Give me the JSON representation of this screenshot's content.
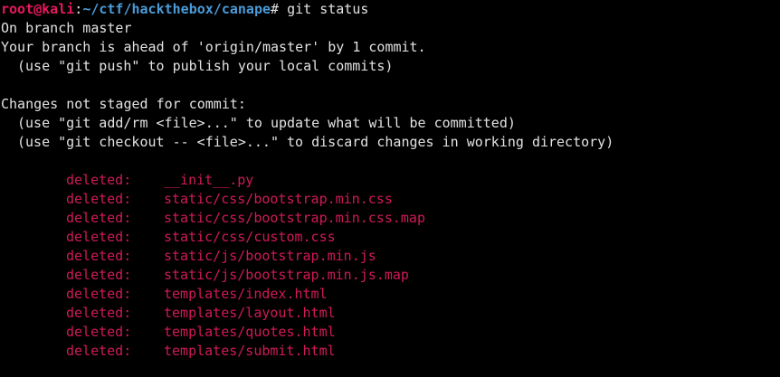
{
  "colors": {
    "background": "#000000",
    "text": "#e2e2e2",
    "prompt_user": "#e8185d",
    "prompt_path": "#4a9bd8",
    "deleted": "#d01a55"
  },
  "prompt": {
    "user_host": "root@kali",
    "separator": ":",
    "path": "~/ctf/hackthebox/canape",
    "symbol": "# ",
    "command": "git status"
  },
  "status": {
    "branch_line": "On branch master",
    "ahead_line": "Your branch is ahead of 'origin/master' by 1 commit.",
    "push_hint": "(use \"git push\" to publish your local commits)",
    "changes_header": "Changes not staged for commit:",
    "add_hint": "(use \"git add/rm <file>...\" to update what will be committed)",
    "checkout_hint": "(use \"git checkout -- <file>...\" to discard changes in working directory)"
  },
  "deleted_files": [
    {
      "status": "deleted:",
      "path": "__init__.py"
    },
    {
      "status": "deleted:",
      "path": "static/css/bootstrap.min.css"
    },
    {
      "status": "deleted:",
      "path": "static/css/bootstrap.min.css.map"
    },
    {
      "status": "deleted:",
      "path": "static/css/custom.css"
    },
    {
      "status": "deleted:",
      "path": "static/js/bootstrap.min.js"
    },
    {
      "status": "deleted:",
      "path": "static/js/bootstrap.min.js.map"
    },
    {
      "status": "deleted:",
      "path": "templates/index.html"
    },
    {
      "status": "deleted:",
      "path": "templates/layout.html"
    },
    {
      "status": "deleted:",
      "path": "templates/quotes.html"
    },
    {
      "status": "deleted:",
      "path": "templates/submit.html"
    }
  ]
}
